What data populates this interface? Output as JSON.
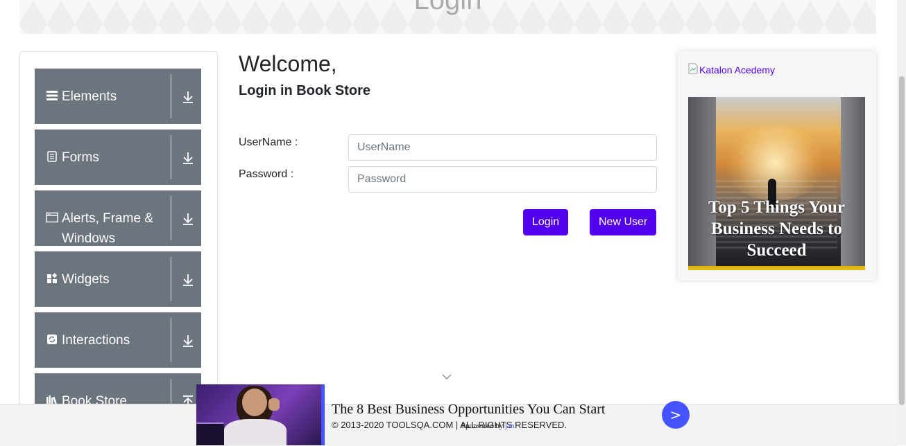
{
  "header": {
    "title": "Login"
  },
  "sidebar": {
    "groups": [
      {
        "label": "Elements",
        "icon": "hamburger-icon",
        "expanded": false
      },
      {
        "label": "Forms",
        "icon": "document-icon",
        "expanded": false
      },
      {
        "label": "Alerts, Frame & Windows",
        "icon": "window-icon",
        "expanded": false
      },
      {
        "label": "Widgets",
        "icon": "widgets-icon",
        "expanded": false
      },
      {
        "label": "Interactions",
        "icon": "refresh-icon",
        "expanded": false
      },
      {
        "label": "Book Store",
        "icon": "books-icon",
        "expanded": true
      }
    ]
  },
  "main": {
    "welcome": "Welcome,",
    "subtitle": "Login in Book Store",
    "username_label": "UserName :",
    "username_placeholder": "UserName",
    "username_value": "",
    "password_label": "Password :",
    "password_placeholder": "Password",
    "password_value": "",
    "login_button": "Login",
    "new_user_button": "New User"
  },
  "ad_panel": {
    "alt_text": "Katalon Acedemy",
    "headline": "Top 5 Things Your Business Needs to Succeed"
  },
  "footer": {
    "copyright": "© 2013-2020 TOOLSQA.COM | ALL RIGHTS RESERVED."
  },
  "bottom_ad": {
    "headline": "The 8 Best Business Opportunities You Can Start",
    "sponsored_prefix": "Sponsored by",
    "sponsor": "jan",
    "go_label": ">"
  },
  "colors": {
    "primary": "#5300ec",
    "sidebar_group": "#6c757d",
    "ad_accent": "#4353ff"
  }
}
